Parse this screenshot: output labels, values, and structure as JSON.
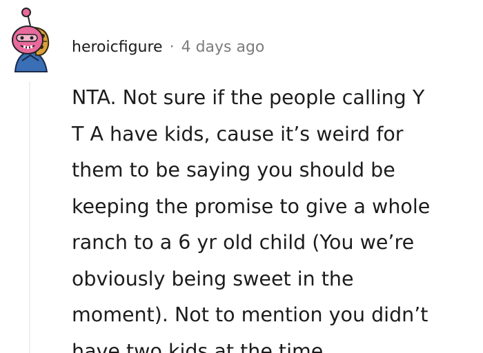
{
  "comment": {
    "author": "heroicfigure",
    "separator": "·",
    "timestamp": "4 days ago",
    "body_lines": [
      "NTA. Not sure if the people calling Y",
      "T A have kids, cause it’s weird for",
      "them to be saying you should be",
      "keeping the promise to give a whole",
      "ranch to a 6 yr old child (You we’re",
      "obviously being sweet in the",
      "moment). Not to mention you didn’t",
      "have two kids at the time."
    ]
  },
  "colors": {
    "text": "#1c1c1c",
    "meta": "#7c7c7c",
    "thread_line": "#edeff1",
    "avatar_pink": "#e86a9c",
    "avatar_blue": "#3a6fb5",
    "avatar_gold": "#d9a13a"
  },
  "icons": {
    "avatar": "snoo-avatar-icon"
  }
}
